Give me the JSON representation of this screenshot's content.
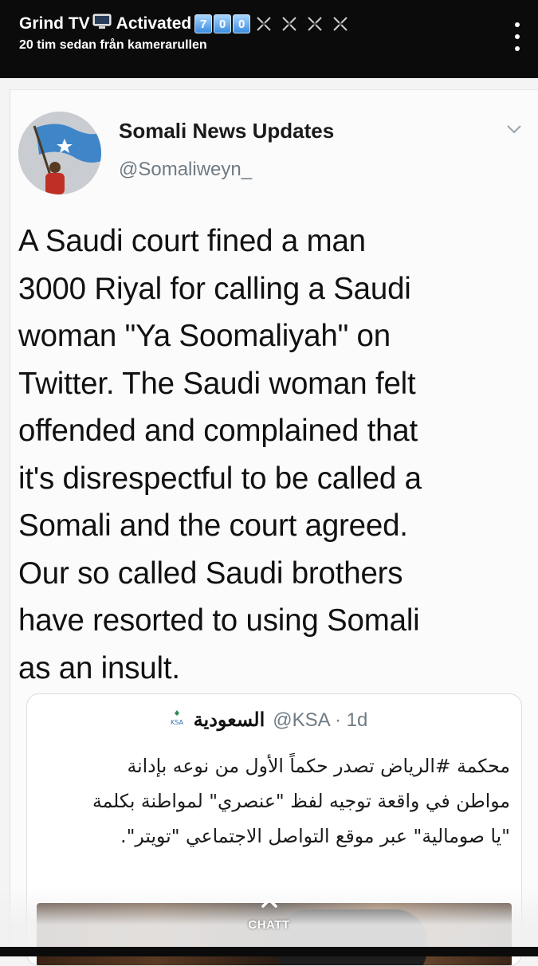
{
  "story": {
    "title_prefix": "Grind TV",
    "title_suffix": "Activated",
    "number_tiles": [
      "7",
      "0",
      "0"
    ],
    "subtitle": "20 tim sedan från kamerarullen",
    "icons": [
      "tv-icon",
      "dagger-icon",
      "menu-icon"
    ]
  },
  "tweet": {
    "author_name": "Somali News Updates",
    "author_handle": "@Somaliweyn_",
    "lines": [
      "A Saudi court fined a man",
      "3000 Riyal for calling a Saudi",
      "woman \"Ya Soomaliyah\" on",
      "Twitter. The Saudi woman felt",
      "offended and complained that",
      "it's disrespectful to be called a",
      "Somali and the court agreed.",
      "Our so called Saudi brothers",
      "have resorted to using Somali",
      "as an insult."
    ],
    "quoted": {
      "name": "السعودية",
      "handle_time": "@KSA · 1d",
      "lines": [
        "محكمة #الرياض تصدر حكماً الأول من نوعه بإدانة",
        "مواطن في واقعة توجيه لفظ \"عنصري\" لمواطنة بكلمة",
        "\"يا صومالية\" عبر موقع التواصل الاجتماعي \"تويتر\"."
      ],
      "logo_text": "KSA"
    }
  },
  "chat": {
    "label": "CHATT"
  },
  "colors": {
    "header_bg": "#0b0b0b",
    "tile_blue": "#3d8de0",
    "handle_gray": "#6f7b84"
  }
}
